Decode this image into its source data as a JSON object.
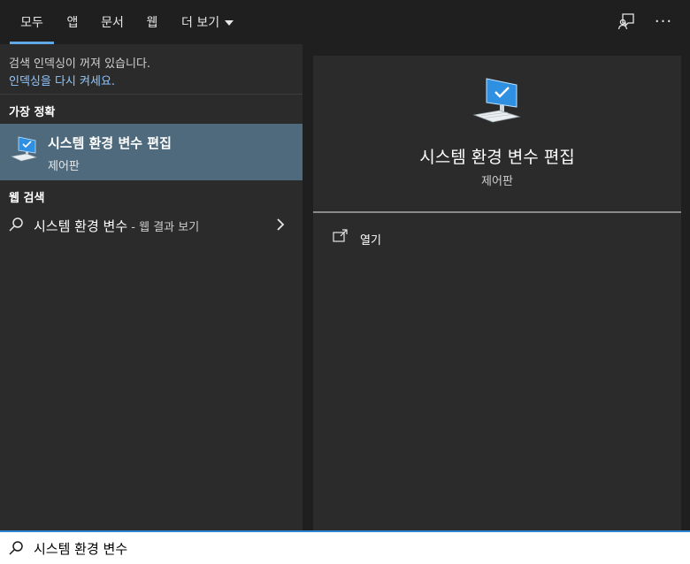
{
  "tabs": [
    {
      "label": "모두",
      "active": true
    },
    {
      "label": "앱"
    },
    {
      "label": "문서"
    },
    {
      "label": "웹"
    },
    {
      "label": "더 보기"
    }
  ],
  "top_icons": {
    "feedback": "feedback-icon",
    "more": "···"
  },
  "index_notice": {
    "text": "검색 인덱싱이 꺼져 있습니다.",
    "link": "인덱싱을 다시 켜세요."
  },
  "best_match": {
    "section_title": "가장 정확",
    "name": "시스템 환경 변수 편집",
    "subtitle": "제어판"
  },
  "web_search": {
    "section_title": "웹 검색",
    "query": "시스템 환경 변수",
    "suffix": " - 웹 결과 보기"
  },
  "preview": {
    "title": "시스템 환경 변수 편집",
    "subtitle": "제어판",
    "actions": [
      {
        "label": "열기",
        "icon": "open-icon"
      }
    ]
  },
  "search": {
    "value": "시스템 환경 변수"
  },
  "colors": {
    "accent": "#5ea9e6",
    "selected_bg": "#4e6a7c",
    "link": "#8fc7ff"
  }
}
